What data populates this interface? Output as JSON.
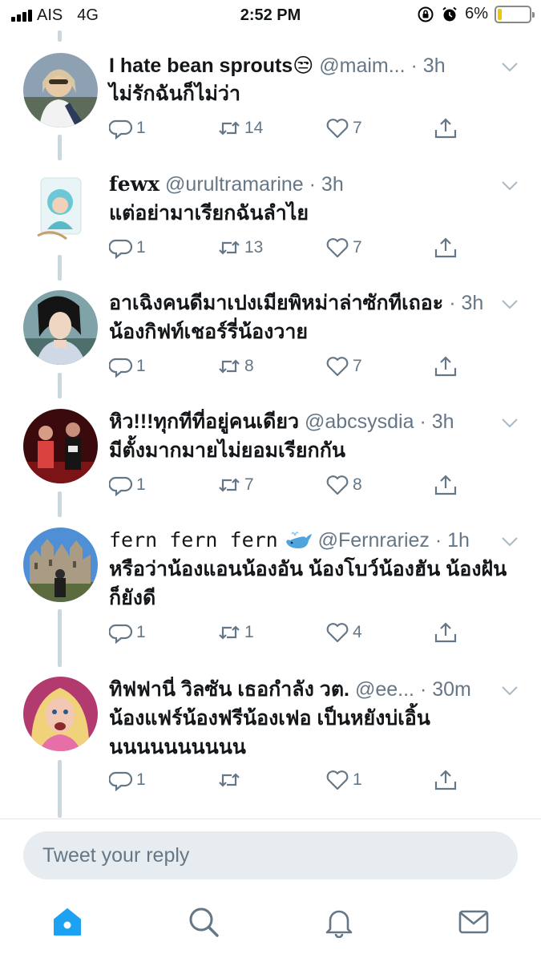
{
  "status_bar": {
    "carrier": "AIS",
    "network": "4G",
    "time": "2:52 PM",
    "battery": "6%",
    "battery_level": 0.06
  },
  "tweets": [
    {
      "name": "I hate bean sprouts",
      "emoji": "😒",
      "handle": "@maim...",
      "time": "· 3h",
      "text": "ไม่รักฉันก็ไม่ว่า",
      "replies": "1",
      "retweets": "14",
      "likes": "7"
    },
    {
      "name": "fewx",
      "handle": "@urultramarine",
      "time": "· 3h",
      "text": "แต่อย่ามาเรียกฉันลำไย",
      "replies": "1",
      "retweets": "13",
      "likes": "7"
    },
    {
      "name": "อาเฉิงคนดีมาเปงเมียพิหม่าล่าซักทีเถอะ",
      "handle": "",
      "time": "· 3h",
      "text": "น้องกิฟท์เชอร์รี่น้องวาย",
      "replies": "1",
      "retweets": "8",
      "likes": "7"
    },
    {
      "name": "หิว!!!ทุกทีที่อยู่คนเดียว",
      "handle": "@abcsysdia",
      "time": "· 3h",
      "text": "มีตั้งมากมายไม่ยอมเรียกกัน",
      "replies": "1",
      "retweets": "7",
      "likes": "8"
    },
    {
      "name": "fern fern fern",
      "emoji": "whale",
      "handle": "@Fernrariez",
      "time": "· 1h",
      "text_line1": "หรือว่าน้องแอนน้องอัน น้องโบว์น้องฮัน น้องฝัน",
      "text_line2": "ก็ยังดี",
      "replies": "1",
      "retweets": "1",
      "likes": "4"
    },
    {
      "name": "ทิฟฟานี่ วิลซัน เธอกำลัง วต.",
      "handle": "@ee...",
      "time": "· 30m",
      "text_line1": "น้องแฟร์น้องฟรีน้องเฟอ เป็นหยังบ่เอิ้น",
      "text_line2": "นนนนนนนนนน",
      "replies": "1",
      "retweets": "",
      "likes": "1"
    }
  ],
  "reply_box": {
    "placeholder": "Tweet your reply"
  },
  "tab_bar": [
    "home-icon",
    "search-icon",
    "notifications-icon",
    "messages-icon"
  ],
  "colors": {
    "accent": "#1da1f2",
    "muted": "#657786",
    "line": "#ccd6dd",
    "input_bg": "#e6ecf0"
  }
}
